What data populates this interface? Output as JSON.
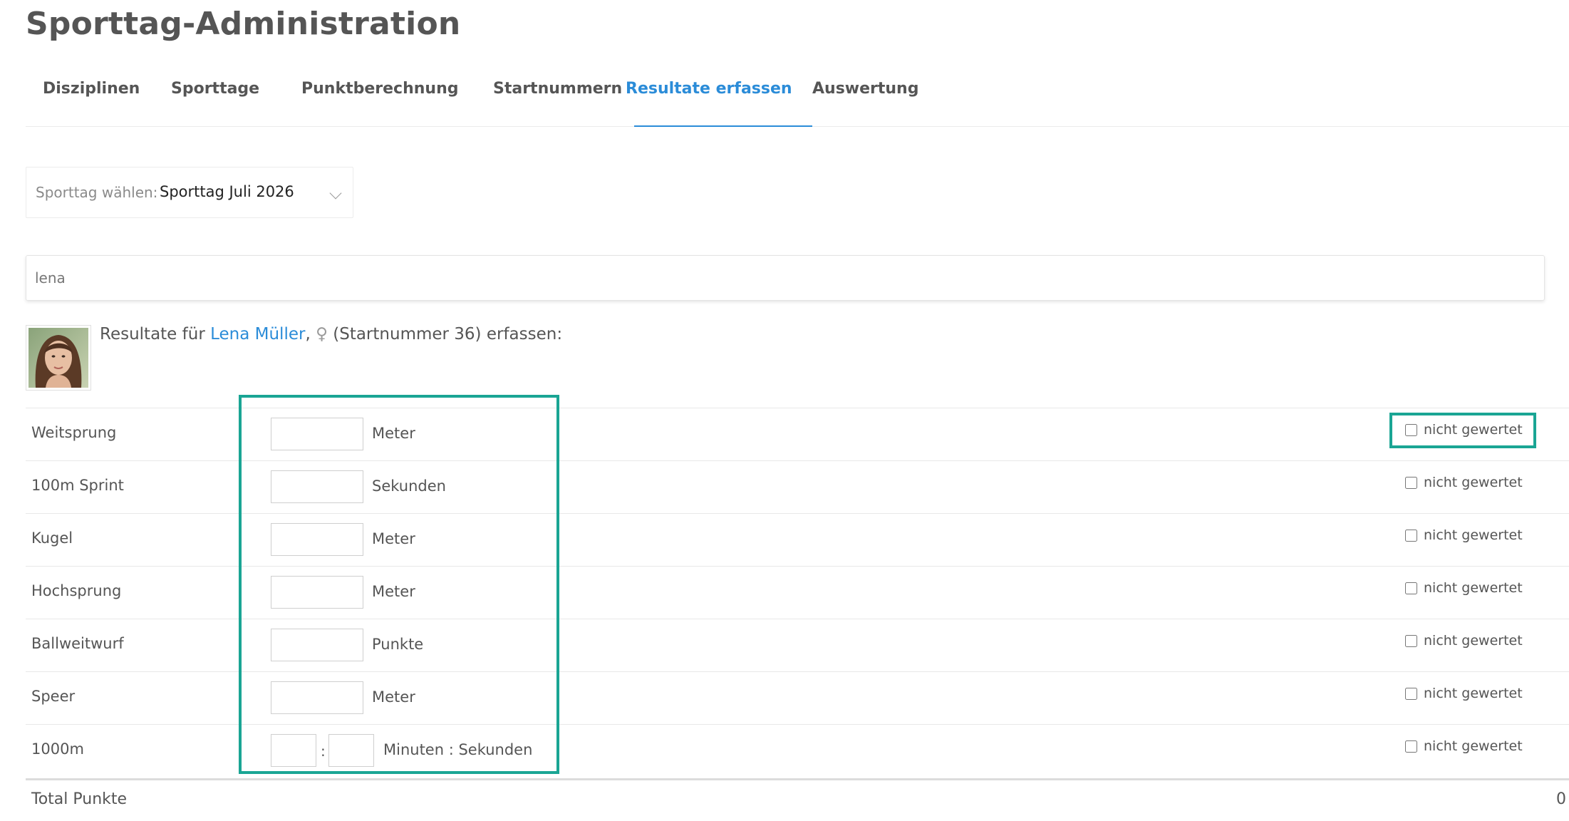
{
  "page_title": "Sporttag-Administration",
  "tabs": [
    {
      "label": "Disziplinen",
      "active": false
    },
    {
      "label": "Sporttage",
      "active": false
    },
    {
      "label": "Punktberechnung",
      "active": false
    },
    {
      "label": "Startnummern",
      "active": false
    },
    {
      "label": "Resultate erfassen",
      "active": true
    },
    {
      "label": "Auswertung",
      "active": false
    }
  ],
  "sporttag_select": {
    "label": "Sporttag wählen:",
    "value": "Sporttag Juli 2026"
  },
  "search": {
    "value": "lena"
  },
  "athlete": {
    "prefix": "Resultate für",
    "name": "Lena Müller",
    "separator": ",",
    "gender_symbol": "♀",
    "suffix": "(Startnummer 36) erfassen:"
  },
  "disciplines": [
    {
      "name": "Weitsprung",
      "unit": "Meter",
      "value": ""
    },
    {
      "name": "100m Sprint",
      "unit": "Sekunden",
      "value": ""
    },
    {
      "name": "Kugel",
      "unit": "Meter",
      "value": ""
    },
    {
      "name": "Hochsprung",
      "unit": "Meter",
      "value": ""
    },
    {
      "name": "Ballweitwurf",
      "unit": "Punkte",
      "value": ""
    },
    {
      "name": "Speer",
      "unit": "Meter",
      "value": ""
    },
    {
      "name": "1000m",
      "unit": "Minuten : Sekunden",
      "minutes": "",
      "seconds": "",
      "separator": ":"
    }
  ],
  "not_scored_label": "nicht gewertet",
  "total": {
    "label": "Total Punkte",
    "value": "0"
  },
  "colors": {
    "accent": "#2b8cd8",
    "highlight": "#1aa594"
  }
}
